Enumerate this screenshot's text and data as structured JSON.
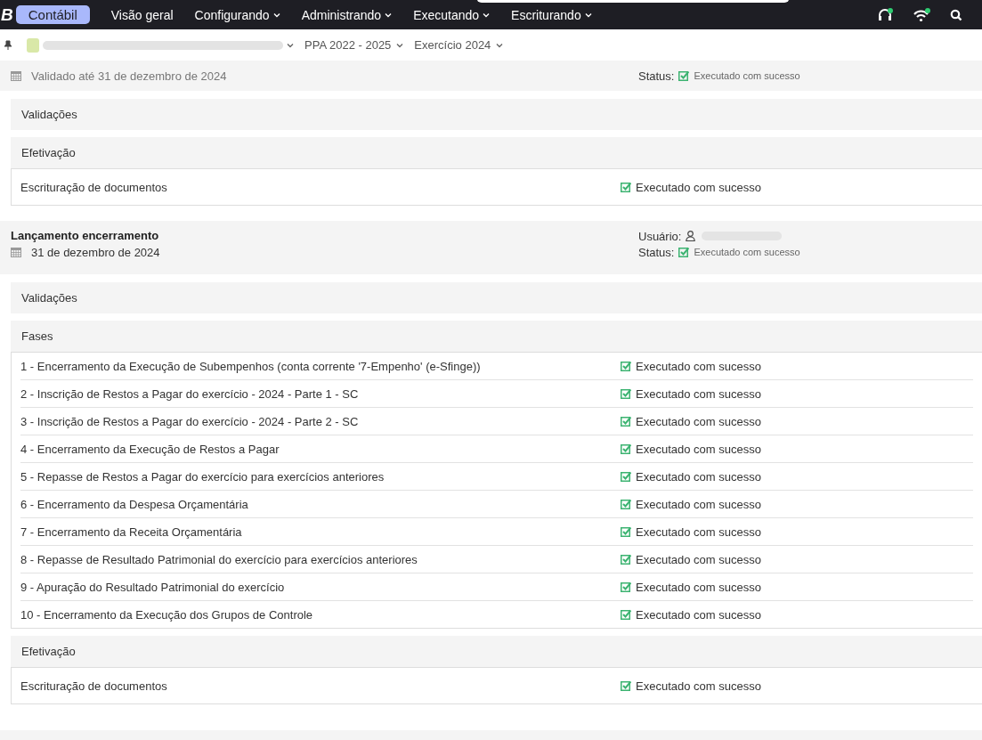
{
  "navbar": {
    "logo": "B",
    "app": "Contábil",
    "menu": [
      {
        "label": "Visão geral",
        "dropdown": false
      },
      {
        "label": "Configurando",
        "dropdown": true
      },
      {
        "label": "Administrando",
        "dropdown": true
      },
      {
        "label": "Executando",
        "dropdown": true
      },
      {
        "label": "Escriturando",
        "dropdown": true
      }
    ]
  },
  "context_bar": {
    "selectors": [
      {
        "label": "PPA 2022 - 2025"
      },
      {
        "label": "Exercício 2024"
      }
    ]
  },
  "processes": [
    {
      "validated": "Validado até 31 de dezembro de 2024",
      "status_label": "Status:",
      "status": "Executado com sucesso",
      "panels": [
        {
          "title": "Validações"
        },
        {
          "title": "Efetivação",
          "rows": [
            {
              "text": "Escrituração de documentos",
              "status": "Executado com sucesso"
            }
          ]
        }
      ]
    },
    {
      "title": "Lançamento encerramento",
      "date": "31 de dezembro de 2024",
      "user_label": "Usuário:",
      "status_label": "Status:",
      "status": "Executado com sucesso",
      "panels": [
        {
          "title": "Validações"
        },
        {
          "title": "Fases",
          "rows": [
            {
              "text": "1 - Encerramento da Execução de Subempenhos (conta corrente '7-Empenho' (e-Sfinge))",
              "status": "Executado com sucesso"
            },
            {
              "text": "2 - Inscrição de Restos a Pagar do exercício - 2024 - Parte 1 - SC",
              "status": "Executado com sucesso"
            },
            {
              "text": "3 - Inscrição de Restos a Pagar do exercício - 2024 - Parte 2 - SC",
              "status": "Executado com sucesso"
            },
            {
              "text": "4 - Encerramento da Execução de Restos a Pagar",
              "status": "Executado com sucesso"
            },
            {
              "text": "5 - Repasse de Restos a Pagar do exercício para exercícios anteriores",
              "status": "Executado com sucesso"
            },
            {
              "text": "6 - Encerramento da Despesa Orçamentária",
              "status": "Executado com sucesso"
            },
            {
              "text": "7 - Encerramento da Receita Orçamentária",
              "status": "Executado com sucesso"
            },
            {
              "text": "8 - Repasse de Resultado Patrimonial do exercício para exercícios anteriores",
              "status": "Executado com sucesso"
            },
            {
              "text": "9 - Apuração do Resultado Patrimonial do exercício",
              "status": "Executado com sucesso"
            },
            {
              "text": "10 - Encerramento da Execução dos Grupos de Controle",
              "status": "Executado com sucesso"
            }
          ]
        },
        {
          "title": "Efetivação",
          "rows": [
            {
              "text": "Escrituração de documentos",
              "status": "Executado com sucesso"
            }
          ]
        }
      ]
    }
  ]
}
